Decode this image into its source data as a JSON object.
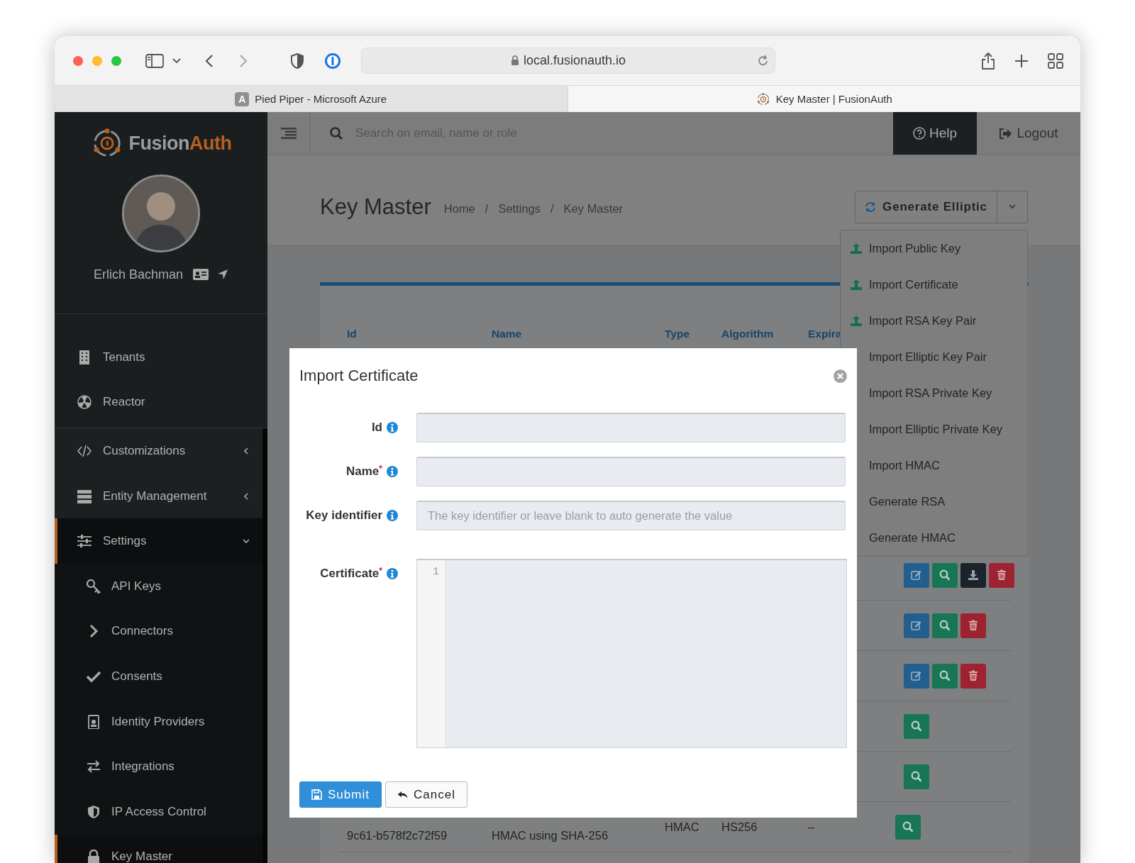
{
  "browser": {
    "url": "local.fusionauth.io",
    "tabs": [
      {
        "title": "Pied Piper - Microsoft Azure",
        "favicon_letter": "A",
        "selected": false
      },
      {
        "title": "Key Master | FusionAuth",
        "selected": true
      }
    ]
  },
  "sidebar": {
    "brand": {
      "first": "Fusion",
      "second": "Auth"
    },
    "user_name": "Erlich Bachman",
    "sections": [
      [
        {
          "label": "Tenants",
          "kind": "item",
          "selected": false
        },
        {
          "label": "Reactor",
          "kind": "item",
          "selected": false
        }
      ],
      [
        {
          "label": "Customizations",
          "kind": "group",
          "expanded": false,
          "selected": false
        },
        {
          "label": "Entity Management",
          "kind": "group",
          "expanded": false,
          "selected": false
        },
        {
          "label": "Settings",
          "kind": "group",
          "expanded": true,
          "selected": true,
          "children": [
            {
              "label": "API Keys",
              "selected": false
            },
            {
              "label": "Connectors",
              "selected": false
            },
            {
              "label": "Consents",
              "selected": false
            },
            {
              "label": "Identity Providers",
              "selected": false
            },
            {
              "label": "Integrations",
              "selected": false
            },
            {
              "label": "IP Access Control",
              "selected": false
            },
            {
              "label": "Key Master",
              "selected": true
            }
          ]
        }
      ]
    ]
  },
  "topbar": {
    "search": {
      "placeholder": "Search on email, name or role"
    },
    "help": "Help",
    "logout": "Logout"
  },
  "header": {
    "title": "Key Master",
    "breadcrumbs": [
      "Home",
      "Settings",
      "Key Master"
    ],
    "separator": "/",
    "action": "Generate Elliptic"
  },
  "dropdown": [
    {
      "label": "Import Public Key",
      "icon": true
    },
    {
      "label": "Import Certificate",
      "icon": true
    },
    {
      "label": "Import RSA Key Pair",
      "icon": true
    },
    {
      "label": "Import Elliptic Key Pair",
      "icon": false
    },
    {
      "label": "Import RSA Private Key",
      "icon": false
    },
    {
      "label": "Import Elliptic Private Key",
      "icon": false
    },
    {
      "label": "Import HMAC",
      "icon": false
    },
    {
      "label": "Generate RSA",
      "icon": false
    },
    {
      "label": "Generate HMAC",
      "icon": false
    }
  ],
  "table": {
    "columns": [
      "Id",
      "Name",
      "Type",
      "Algorithm",
      "Expira"
    ],
    "rows": [
      {
        "actions": [
          {
            "kind": "edit"
          },
          {
            "kind": "view"
          },
          {
            "kind": "download"
          },
          {
            "kind": "delete"
          }
        ]
      },
      {
        "actions": [
          {
            "kind": "edit"
          },
          {
            "kind": "view"
          },
          {
            "kind": "delete"
          }
        ]
      },
      {
        "actions": [
          {
            "kind": "edit"
          },
          {
            "kind": "view"
          },
          {
            "kind": "delete"
          }
        ]
      },
      {
        "actions": [
          {
            "kind": "view"
          }
        ]
      },
      {
        "actions": [
          {
            "kind": "view"
          }
        ]
      },
      {
        "cells": [
          "9c61-b578f2c72f59",
          "HMAC using SHA-256",
          "HMAC",
          "HS256",
          "–"
        ],
        "actions": [
          {
            "kind": "view"
          }
        ]
      }
    ]
  },
  "modal": {
    "title": "Import Certificate",
    "required_mark": "*",
    "fields": [
      {
        "label": "Id",
        "required": false,
        "kind": "input"
      },
      {
        "label": "Name",
        "required": true,
        "kind": "input"
      },
      {
        "label": "Key identifier",
        "required": false,
        "kind": "input",
        "placeholder": "The key identifier or leave blank to auto generate the value"
      },
      {
        "label": "Certificate",
        "required": true,
        "kind": "code",
        "line_number": "1"
      }
    ],
    "buttons": [
      {
        "label": "Submit",
        "kind": "primary"
      },
      {
        "label": "Cancel",
        "kind": "default"
      }
    ]
  }
}
